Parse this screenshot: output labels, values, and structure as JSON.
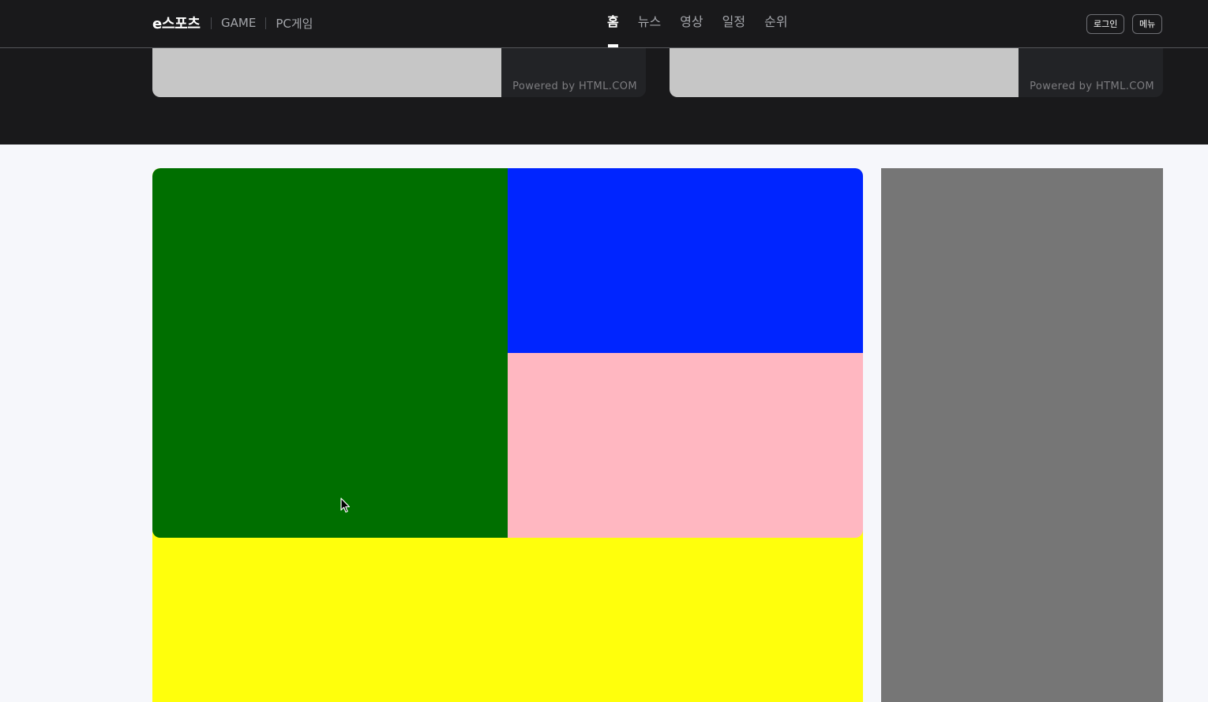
{
  "header": {
    "brand": "e스포츠",
    "subnav": [
      "GAME",
      "PC게임"
    ],
    "nav": [
      {
        "label": "홈",
        "active": true
      },
      {
        "label": "뉴스",
        "active": false
      },
      {
        "label": "영상",
        "active": false
      },
      {
        "label": "일정",
        "active": false
      },
      {
        "label": "순위",
        "active": false
      }
    ],
    "login_label": "로그인",
    "menu_label": "메뉴"
  },
  "ads": {
    "left_caption": "Powered by HTML.COM",
    "right_caption": "Powered by HTML.COM"
  },
  "colors": {
    "header_bg": "#19191b",
    "page_bg": "#f6f7fb",
    "tile_green": "#006f00",
    "tile_blue": "#0025ff",
    "tile_pink": "#ffb7c1",
    "tile_yellow": "#ffff0c",
    "side_gray": "#767676"
  }
}
